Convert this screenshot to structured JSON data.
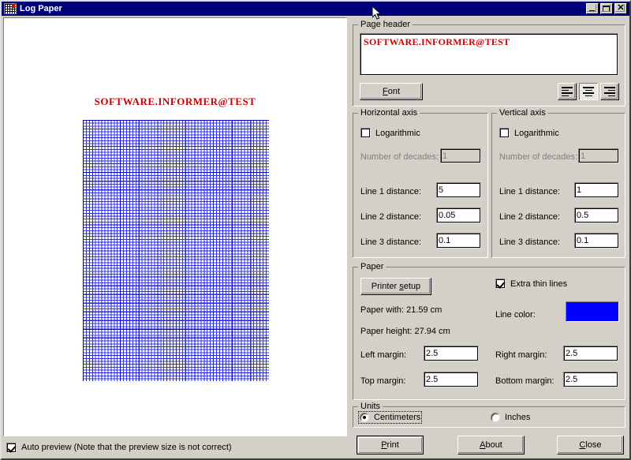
{
  "window": {
    "title": "Log Paper",
    "icon": "grid-paper-icon",
    "controls": {
      "minimize": "_",
      "maximize": "□",
      "close": "✕"
    }
  },
  "preview": {
    "header_text": "SOFTWARE.INFORMER@TEST",
    "header_color": "#cc0000",
    "grid_color": "#0000d0",
    "paper_background": "#ffffff"
  },
  "statusbar": {
    "auto_preview_label": "Auto preview (Note that the preview size is not correct)",
    "auto_preview_checked": true
  },
  "page_header": {
    "group_label": "Page header",
    "text": "SOFTWARE.INFORMER@TEST",
    "text_color": "#cc0000",
    "font_button": "Font",
    "font_button_accel": "F",
    "align_left": "align-left",
    "align_center": "align-center",
    "align_right": "align-right",
    "align_selected": "center"
  },
  "horizontal_axis": {
    "group_label": "Horizontal axis",
    "logarithmic_label": "Logarithmic",
    "logarithmic_checked": false,
    "decades_label": "Number of decades:",
    "decades_value": "1",
    "decades_enabled": false,
    "line1_label": "Line 1 distance:",
    "line1_value": "5",
    "line2_label": "Line 2 distance:",
    "line2_value": "0.05",
    "line3_label": "Line 3 distance:",
    "line3_value": "0.1"
  },
  "vertical_axis": {
    "group_label": "Vertical axis",
    "logarithmic_label": "Logarithmic",
    "logarithmic_checked": false,
    "decades_label": "Number of decades:",
    "decades_value": "1",
    "decades_enabled": false,
    "line1_label": "Line 1 distance:",
    "line1_value": "1",
    "line2_label": "Line 2 distance:",
    "line2_value": "0.5",
    "line3_label": "Line 3 distance:",
    "line3_value": "0.1"
  },
  "paper": {
    "group_label": "Paper",
    "printer_setup_button": "Printer setup",
    "paper_width_label": "Paper with: 21.59 cm",
    "paper_height_label": "Paper height: 27.94 cm",
    "extra_thin_lines_label": "Extra thin lines",
    "extra_thin_lines_checked": true,
    "line_color_label": "Line color:",
    "line_color_value": "#0000ff",
    "left_margin_label": "Left margin:",
    "left_margin_value": "2.5",
    "right_margin_label": "Right margin:",
    "right_margin_value": "2.5",
    "top_margin_label": "Top margin:",
    "top_margin_value": "2.5",
    "bottom_margin_label": "Bottom margin:",
    "bottom_margin_value": "2.5"
  },
  "units": {
    "group_label": "Units",
    "centimeters_label": "Centimeters",
    "inches_label": "Inches",
    "selected": "Centimeters"
  },
  "actions": {
    "print": "Print",
    "about": "About",
    "close": "Close"
  }
}
